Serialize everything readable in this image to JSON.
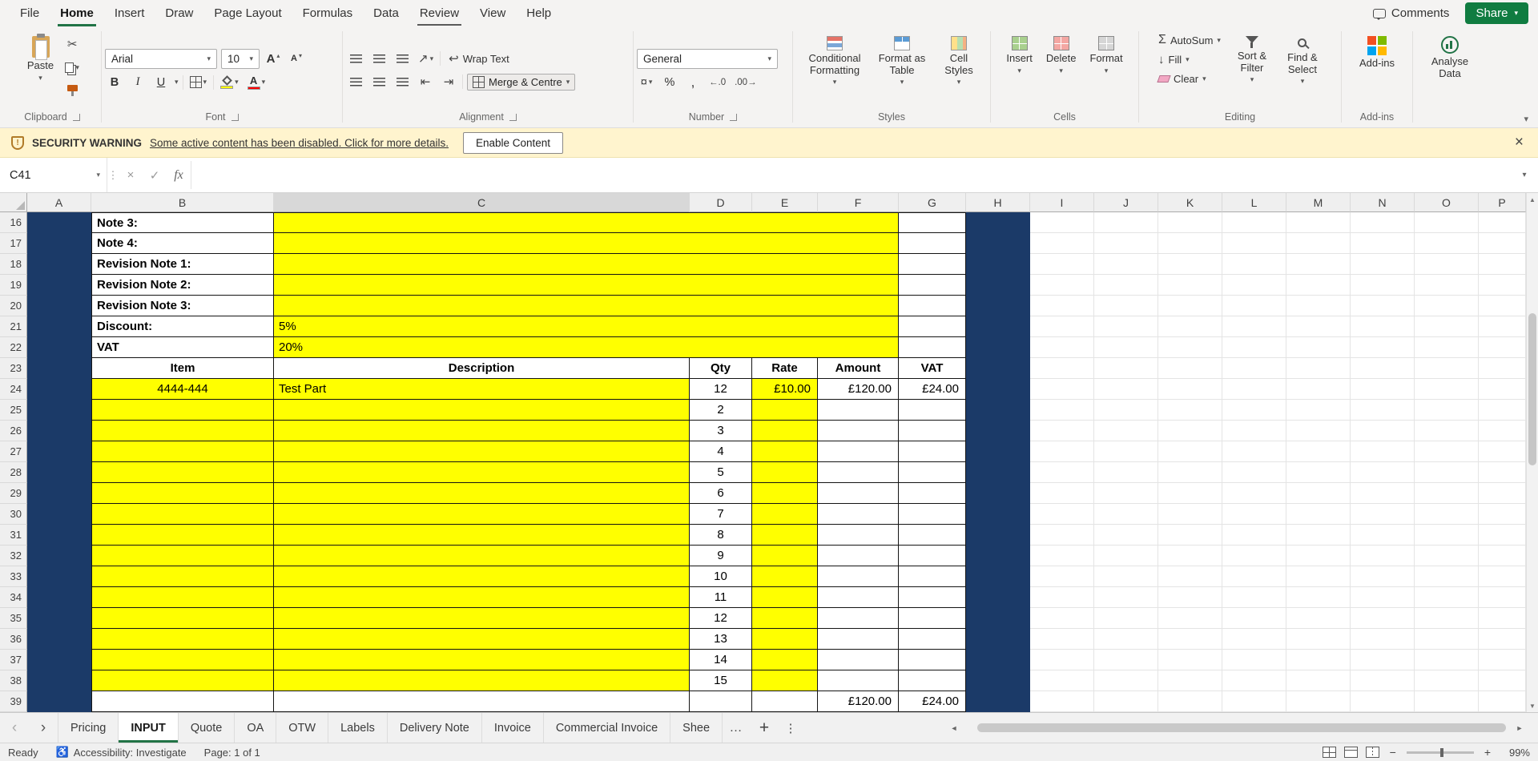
{
  "menubar": {
    "items": [
      {
        "label": "File"
      },
      {
        "label": "Home",
        "active": true
      },
      {
        "label": "Insert"
      },
      {
        "label": "Draw"
      },
      {
        "label": "Page Layout"
      },
      {
        "label": "Formulas"
      },
      {
        "label": "Data"
      },
      {
        "label": "Review",
        "underlined": true
      },
      {
        "label": "View"
      },
      {
        "label": "Help"
      }
    ],
    "comments": "Comments",
    "share": "Share"
  },
  "ribbon": {
    "clipboard": {
      "label": "Clipboard",
      "paste": "Paste"
    },
    "font": {
      "label": "Font",
      "family": "Arial",
      "size": "10",
      "bold": "B",
      "italic": "I",
      "underline": "U"
    },
    "alignment": {
      "label": "Alignment",
      "wrap": "Wrap Text",
      "merge": "Merge & Centre"
    },
    "number": {
      "label": "Number",
      "format": "General",
      "percent": "%",
      "comma": ","
    },
    "styles": {
      "label": "Styles",
      "conditional": "Conditional Formatting",
      "format_table": "Format as Table",
      "cell_styles": "Cell Styles"
    },
    "cells": {
      "label": "Cells",
      "insert": "Insert",
      "delete": "Delete",
      "format": "Format"
    },
    "editing": {
      "label": "Editing",
      "autosum": "AutoSum",
      "fill": "Fill",
      "clear": "Clear",
      "sort": "Sort & Filter",
      "find": "Find & Select"
    },
    "addins": {
      "label": "Add-ins",
      "button": "Add-ins"
    },
    "analyse": {
      "button": "Analyse Data"
    }
  },
  "security": {
    "badge": "SECURITY WARNING",
    "message": "Some active content has been disabled. Click for more details.",
    "action": "Enable Content"
  },
  "formula_bar": {
    "cell_ref": "C41",
    "fx_label": "fx",
    "formula": ""
  },
  "grid": {
    "col_letters": [
      "A",
      "B",
      "C",
      "D",
      "E",
      "F",
      "G",
      "H",
      "I",
      "J",
      "K",
      "L",
      "M",
      "N",
      "O",
      "P"
    ],
    "active_col": "C",
    "row_start": 16,
    "row_end": 39,
    "note_rows": [
      {
        "row": 16,
        "label": "Note 3:",
        "value": ""
      },
      {
        "row": 17,
        "label": "Note 4:",
        "value": ""
      },
      {
        "row": 18,
        "label": "Revision Note 1:",
        "value": ""
      },
      {
        "row": 19,
        "label": "Revision Note 2:",
        "value": ""
      },
      {
        "row": 20,
        "label": "Revision Note 3:",
        "value": ""
      },
      {
        "row": 21,
        "label": "Discount:",
        "value": "5%"
      },
      {
        "row": 22,
        "label": "VAT",
        "value": "20%"
      }
    ],
    "header_row": {
      "row": 23,
      "cells": [
        "Item",
        "Description",
        "Qty",
        "Rate",
        "Amount",
        "VAT"
      ]
    },
    "data_rows": [
      {
        "row": 24,
        "item": "4444-444",
        "description": "Test Part",
        "qty": "12",
        "rate": "£10.00",
        "amount": "£120.00",
        "vat": "£24.00"
      },
      {
        "row": 25,
        "item": "",
        "description": "",
        "qty": "2",
        "rate": "",
        "amount": "",
        "vat": ""
      },
      {
        "row": 26,
        "item": "",
        "description": "",
        "qty": "3",
        "rate": "",
        "amount": "",
        "vat": ""
      },
      {
        "row": 27,
        "item": "",
        "description": "",
        "qty": "4",
        "rate": "",
        "amount": "",
        "vat": ""
      },
      {
        "row": 28,
        "item": "",
        "description": "",
        "qty": "5",
        "rate": "",
        "amount": "",
        "vat": ""
      },
      {
        "row": 29,
        "item": "",
        "description": "",
        "qty": "6",
        "rate": "",
        "amount": "",
        "vat": ""
      },
      {
        "row": 30,
        "item": "",
        "description": "",
        "qty": "7",
        "rate": "",
        "amount": "",
        "vat": ""
      },
      {
        "row": 31,
        "item": "",
        "description": "",
        "qty": "8",
        "rate": "",
        "amount": "",
        "vat": ""
      },
      {
        "row": 32,
        "item": "",
        "description": "",
        "qty": "9",
        "rate": "",
        "amount": "",
        "vat": ""
      },
      {
        "row": 33,
        "item": "",
        "description": "",
        "qty": "10",
        "rate": "",
        "amount": "",
        "vat": ""
      },
      {
        "row": 34,
        "item": "",
        "description": "",
        "qty": "11",
        "rate": "",
        "amount": "",
        "vat": ""
      },
      {
        "row": 35,
        "item": "",
        "description": "",
        "qty": "12",
        "rate": "",
        "amount": "",
        "vat": ""
      },
      {
        "row": 36,
        "item": "",
        "description": "",
        "qty": "13",
        "rate": "",
        "amount": "",
        "vat": ""
      },
      {
        "row": 37,
        "item": "",
        "description": "",
        "qty": "14",
        "rate": "",
        "amount": "",
        "vat": ""
      },
      {
        "row": 38,
        "item": "",
        "description": "",
        "qty": "15",
        "rate": "",
        "amount": "",
        "vat": ""
      }
    ],
    "total_row": {
      "row": 39,
      "amount": "£120.00",
      "vat": "£24.00"
    }
  },
  "sheet_tabs": {
    "tabs": [
      "Pricing",
      "INPUT",
      "Quote",
      "OA",
      "OTW",
      "Labels",
      "Delivery Note",
      "Invoice",
      "Commercial Invoice",
      "Shee"
    ],
    "active": "INPUT"
  },
  "status_bar": {
    "mode": "Ready",
    "accessibility": "Accessibility: Investigate",
    "page": "Page: 1 of 1",
    "zoom": "99%"
  },
  "colors": {
    "accent_green": "#217346",
    "sheet_navy": "#1B3A68",
    "input_yellow": "#FFFF00"
  }
}
